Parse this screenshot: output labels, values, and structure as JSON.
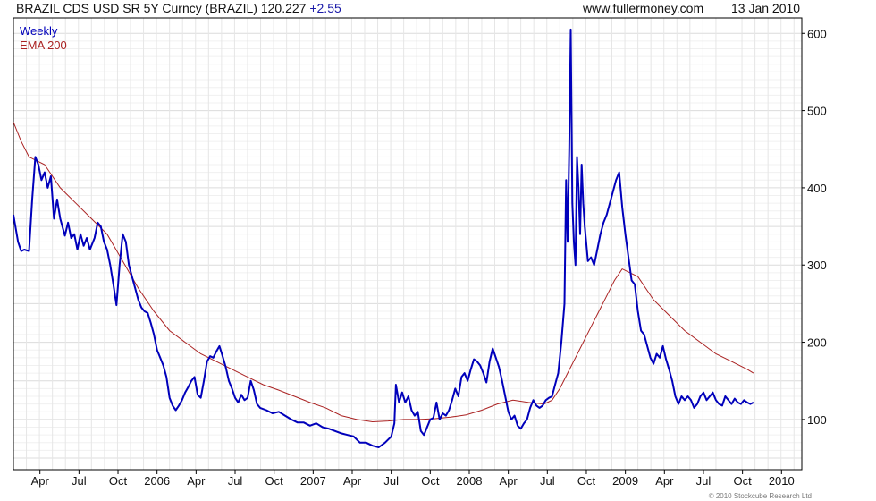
{
  "header": {
    "title": "BRAZIL CDS USD SR 5Y Curncy (BRAZIL) 120.227",
    "change": "+2.55",
    "site": "www.fullermoney.com",
    "date": "13 Jan 2010"
  },
  "copyright": "© 2010 Stockcube Research Ltd",
  "colors": {
    "weekly": "#0000bb",
    "ema": "#aa2222",
    "grid": "#e3e3e3",
    "axis": "#000000"
  },
  "chart_data": {
    "type": "line",
    "title": "BRAZIL CDS USD SR 5Y Curncy (BRAZIL) 120.227 +2.55",
    "xlim": [
      2005.0,
      2010.05
    ],
    "ylim": [
      35,
      620
    ],
    "y_ticks": [
      100,
      200,
      300,
      400,
      500,
      600
    ],
    "x_ticks": [
      {
        "label": "Apr",
        "x": 2005.17
      },
      {
        "label": "Jul",
        "x": 2005.42
      },
      {
        "label": "Oct",
        "x": 2005.67
      },
      {
        "label": "2006",
        "x": 2005.92
      },
      {
        "label": "Apr",
        "x": 2006.17
      },
      {
        "label": "Jul",
        "x": 2006.42
      },
      {
        "label": "Oct",
        "x": 2006.67
      },
      {
        "label": "2007",
        "x": 2006.92
      },
      {
        "label": "Apr",
        "x": 2007.17
      },
      {
        "label": "Jul",
        "x": 2007.42
      },
      {
        "label": "Oct",
        "x": 2007.67
      },
      {
        "label": "2008",
        "x": 2007.92
      },
      {
        "label": "Apr",
        "x": 2008.17
      },
      {
        "label": "Jul",
        "x": 2008.42
      },
      {
        "label": "Oct",
        "x": 2008.67
      },
      {
        "label": "2009",
        "x": 2008.92
      },
      {
        "label": "Apr",
        "x": 2009.17
      },
      {
        "label": "Jul",
        "x": 2009.42
      },
      {
        "label": "Oct",
        "x": 2009.67
      },
      {
        "label": "2010",
        "x": 2009.92
      }
    ],
    "grid": true,
    "legend": "top-left",
    "series": [
      {
        "name": "Weekly",
        "points": [
          [
            2005.0,
            365
          ],
          [
            2005.03,
            330
          ],
          [
            2005.05,
            318
          ],
          [
            2005.07,
            320
          ],
          [
            2005.1,
            318
          ],
          [
            2005.12,
            385
          ],
          [
            2005.14,
            440
          ],
          [
            2005.16,
            430
          ],
          [
            2005.18,
            410
          ],
          [
            2005.2,
            420
          ],
          [
            2005.22,
            400
          ],
          [
            2005.24,
            415
          ],
          [
            2005.26,
            360
          ],
          [
            2005.28,
            385
          ],
          [
            2005.3,
            360
          ],
          [
            2005.33,
            338
          ],
          [
            2005.35,
            355
          ],
          [
            2005.37,
            335
          ],
          [
            2005.39,
            340
          ],
          [
            2005.41,
            320
          ],
          [
            2005.43,
            340
          ],
          [
            2005.45,
            325
          ],
          [
            2005.47,
            335
          ],
          [
            2005.49,
            320
          ],
          [
            2005.52,
            335
          ],
          [
            2005.54,
            355
          ],
          [
            2005.56,
            350
          ],
          [
            2005.58,
            330
          ],
          [
            2005.6,
            320
          ],
          [
            2005.62,
            300
          ],
          [
            2005.64,
            275
          ],
          [
            2005.66,
            248
          ],
          [
            2005.68,
            300
          ],
          [
            2005.7,
            340
          ],
          [
            2005.72,
            330
          ],
          [
            2005.74,
            300
          ],
          [
            2005.76,
            285
          ],
          [
            2005.78,
            270
          ],
          [
            2005.8,
            255
          ],
          [
            2005.82,
            245
          ],
          [
            2005.84,
            240
          ],
          [
            2005.86,
            238
          ],
          [
            2005.88,
            225
          ],
          [
            2005.9,
            210
          ],
          [
            2005.92,
            190
          ],
          [
            2005.94,
            180
          ],
          [
            2005.96,
            170
          ],
          [
            2005.98,
            155
          ],
          [
            2006.0,
            128
          ],
          [
            2006.02,
            118
          ],
          [
            2006.04,
            112
          ],
          [
            2006.06,
            118
          ],
          [
            2006.08,
            125
          ],
          [
            2006.1,
            135
          ],
          [
            2006.12,
            142
          ],
          [
            2006.14,
            150
          ],
          [
            2006.16,
            155
          ],
          [
            2006.18,
            132
          ],
          [
            2006.2,
            128
          ],
          [
            2006.22,
            150
          ],
          [
            2006.24,
            175
          ],
          [
            2006.26,
            182
          ],
          [
            2006.28,
            180
          ],
          [
            2006.3,
            188
          ],
          [
            2006.32,
            195
          ],
          [
            2006.34,
            182
          ],
          [
            2006.36,
            168
          ],
          [
            2006.38,
            150
          ],
          [
            2006.4,
            140
          ],
          [
            2006.42,
            128
          ],
          [
            2006.44,
            122
          ],
          [
            2006.46,
            132
          ],
          [
            2006.48,
            125
          ],
          [
            2006.5,
            128
          ],
          [
            2006.52,
            150
          ],
          [
            2006.54,
            138
          ],
          [
            2006.56,
            120
          ],
          [
            2006.58,
            115
          ],
          [
            2006.62,
            112
          ],
          [
            2006.66,
            108
          ],
          [
            2006.7,
            110
          ],
          [
            2006.74,
            105
          ],
          [
            2006.78,
            100
          ],
          [
            2006.82,
            96
          ],
          [
            2006.86,
            96
          ],
          [
            2006.9,
            92
          ],
          [
            2006.94,
            95
          ],
          [
            2006.98,
            90
          ],
          [
            2007.02,
            88
          ],
          [
            2007.06,
            85
          ],
          [
            2007.1,
            82
          ],
          [
            2007.14,
            80
          ],
          [
            2007.18,
            78
          ],
          [
            2007.22,
            70
          ],
          [
            2007.26,
            70
          ],
          [
            2007.3,
            66
          ],
          [
            2007.34,
            64
          ],
          [
            2007.38,
            70
          ],
          [
            2007.42,
            78
          ],
          [
            2007.44,
            95
          ],
          [
            2007.45,
            145
          ],
          [
            2007.47,
            122
          ],
          [
            2007.49,
            135
          ],
          [
            2007.51,
            122
          ],
          [
            2007.53,
            130
          ],
          [
            2007.55,
            112
          ],
          [
            2007.57,
            105
          ],
          [
            2007.59,
            110
          ],
          [
            2007.61,
            85
          ],
          [
            2007.63,
            80
          ],
          [
            2007.65,
            90
          ],
          [
            2007.67,
            100
          ],
          [
            2007.69,
            102
          ],
          [
            2007.71,
            122
          ],
          [
            2007.73,
            100
          ],
          [
            2007.75,
            108
          ],
          [
            2007.77,
            105
          ],
          [
            2007.79,
            112
          ],
          [
            2007.81,
            125
          ],
          [
            2007.83,
            140
          ],
          [
            2007.85,
            130
          ],
          [
            2007.87,
            155
          ],
          [
            2007.89,
            160
          ],
          [
            2007.91,
            150
          ],
          [
            2007.93,
            165
          ],
          [
            2007.95,
            178
          ],
          [
            2007.97,
            175
          ],
          [
            2007.99,
            170
          ],
          [
            2008.01,
            160
          ],
          [
            2008.03,
            148
          ],
          [
            2008.05,
            175
          ],
          [
            2008.07,
            192
          ],
          [
            2008.09,
            180
          ],
          [
            2008.11,
            168
          ],
          [
            2008.13,
            150
          ],
          [
            2008.15,
            130
          ],
          [
            2008.17,
            110
          ],
          [
            2008.19,
            100
          ],
          [
            2008.21,
            105
          ],
          [
            2008.23,
            92
          ],
          [
            2008.25,
            88
          ],
          [
            2008.27,
            95
          ],
          [
            2008.29,
            100
          ],
          [
            2008.31,
            115
          ],
          [
            2008.33,
            125
          ],
          [
            2008.35,
            118
          ],
          [
            2008.37,
            115
          ],
          [
            2008.39,
            118
          ],
          [
            2008.41,
            125
          ],
          [
            2008.43,
            128
          ],
          [
            2008.45,
            130
          ],
          [
            2008.47,
            145
          ],
          [
            2008.49,
            160
          ],
          [
            2008.51,
            200
          ],
          [
            2008.53,
            250
          ],
          [
            2008.54,
            410
          ],
          [
            2008.55,
            330
          ],
          [
            2008.56,
            450
          ],
          [
            2008.57,
            605
          ],
          [
            2008.58,
            380
          ],
          [
            2008.59,
            330
          ],
          [
            2008.6,
            300
          ],
          [
            2008.61,
            440
          ],
          [
            2008.62,
            400
          ],
          [
            2008.63,
            340
          ],
          [
            2008.64,
            430
          ],
          [
            2008.65,
            380
          ],
          [
            2008.66,
            350
          ],
          [
            2008.68,
            305
          ],
          [
            2008.7,
            310
          ],
          [
            2008.72,
            300
          ],
          [
            2008.74,
            320
          ],
          [
            2008.76,
            340
          ],
          [
            2008.78,
            355
          ],
          [
            2008.8,
            365
          ],
          [
            2008.82,
            380
          ],
          [
            2008.84,
            395
          ],
          [
            2008.86,
            410
          ],
          [
            2008.88,
            420
          ],
          [
            2008.9,
            375
          ],
          [
            2008.92,
            340
          ],
          [
            2008.94,
            310
          ],
          [
            2008.96,
            280
          ],
          [
            2008.98,
            275
          ],
          [
            2009.0,
            240
          ],
          [
            2009.02,
            215
          ],
          [
            2009.04,
            210
          ],
          [
            2009.06,
            195
          ],
          [
            2009.08,
            180
          ],
          [
            2009.1,
            172
          ],
          [
            2009.12,
            185
          ],
          [
            2009.14,
            180
          ],
          [
            2009.16,
            195
          ],
          [
            2009.18,
            178
          ],
          [
            2009.2,
            165
          ],
          [
            2009.22,
            150
          ],
          [
            2009.24,
            130
          ],
          [
            2009.26,
            120
          ],
          [
            2009.28,
            130
          ],
          [
            2009.3,
            125
          ],
          [
            2009.32,
            130
          ],
          [
            2009.34,
            125
          ],
          [
            2009.36,
            115
          ],
          [
            2009.38,
            120
          ],
          [
            2009.4,
            130
          ],
          [
            2009.42,
            135
          ],
          [
            2009.44,
            125
          ],
          [
            2009.46,
            130
          ],
          [
            2009.48,
            135
          ],
          [
            2009.5,
            125
          ],
          [
            2009.52,
            120
          ],
          [
            2009.54,
            118
          ],
          [
            2009.56,
            130
          ],
          [
            2009.58,
            125
          ],
          [
            2009.6,
            120
          ],
          [
            2009.62,
            127
          ],
          [
            2009.64,
            122
          ],
          [
            2009.66,
            120
          ],
          [
            2009.68,
            125
          ],
          [
            2009.7,
            122
          ],
          [
            2009.72,
            120
          ],
          [
            2009.74,
            122
          ]
        ]
      },
      {
        "name": "EMA 200",
        "points": [
          [
            2005.0,
            485
          ],
          [
            2005.05,
            460
          ],
          [
            2005.1,
            440
          ],
          [
            2005.2,
            430
          ],
          [
            2005.3,
            400
          ],
          [
            2005.4,
            380
          ],
          [
            2005.5,
            360
          ],
          [
            2005.6,
            340
          ],
          [
            2005.7,
            305
          ],
          [
            2005.8,
            270
          ],
          [
            2005.9,
            240
          ],
          [
            2006.0,
            215
          ],
          [
            2006.1,
            200
          ],
          [
            2006.2,
            185
          ],
          [
            2006.3,
            175
          ],
          [
            2006.4,
            165
          ],
          [
            2006.5,
            155
          ],
          [
            2006.6,
            145
          ],
          [
            2006.7,
            138
          ],
          [
            2006.8,
            130
          ],
          [
            2006.9,
            122
          ],
          [
            2007.0,
            115
          ],
          [
            2007.1,
            105
          ],
          [
            2007.2,
            100
          ],
          [
            2007.3,
            97
          ],
          [
            2007.4,
            98
          ],
          [
            2007.5,
            100
          ],
          [
            2007.6,
            100
          ],
          [
            2007.7,
            101
          ],
          [
            2007.8,
            103
          ],
          [
            2007.9,
            106
          ],
          [
            2008.0,
            112
          ],
          [
            2008.1,
            120
          ],
          [
            2008.2,
            125
          ],
          [
            2008.3,
            122
          ],
          [
            2008.4,
            120
          ],
          [
            2008.45,
            125
          ],
          [
            2008.5,
            140
          ],
          [
            2008.55,
            160
          ],
          [
            2008.6,
            180
          ],
          [
            2008.65,
            200
          ],
          [
            2008.7,
            220
          ],
          [
            2008.75,
            240
          ],
          [
            2008.8,
            260
          ],
          [
            2008.85,
            280
          ],
          [
            2008.9,
            295
          ],
          [
            2008.95,
            290
          ],
          [
            2009.0,
            285
          ],
          [
            2009.05,
            270
          ],
          [
            2009.1,
            255
          ],
          [
            2009.2,
            235
          ],
          [
            2009.3,
            215
          ],
          [
            2009.4,
            200
          ],
          [
            2009.5,
            185
          ],
          [
            2009.6,
            175
          ],
          [
            2009.7,
            165
          ],
          [
            2009.74,
            160
          ]
        ]
      }
    ]
  }
}
